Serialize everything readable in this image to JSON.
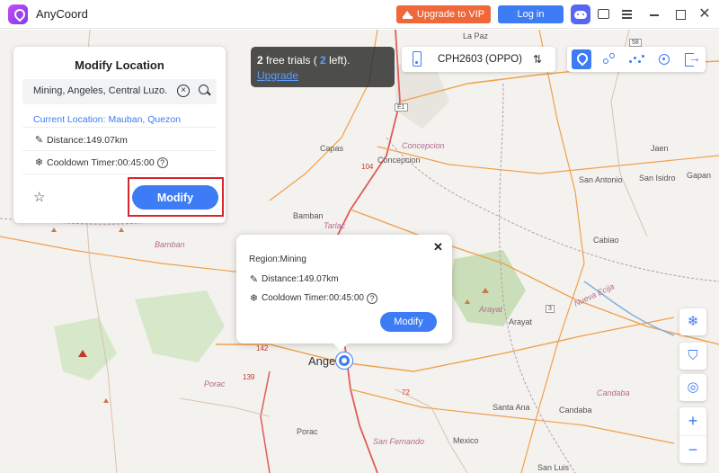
{
  "app": {
    "title": "AnyCoord"
  },
  "titlebar": {
    "upgrade_label": "Upgrade to VIP",
    "login_label": "Log in",
    "close_glyph": "✕"
  },
  "modify_panel": {
    "title": "Modify Location",
    "search_value": "Mining, Angeles, Central Luzo...",
    "current_location": "Current Location: Mauban, Quezon",
    "distance": "Distance:149.07km",
    "cooldown": "Cooldown Timer:00:45:00",
    "modify_label": "Modify"
  },
  "trial": {
    "count": "2",
    "text_mid": " free trials ( ",
    "left_count": "2",
    "text_end": " left).",
    "upgrade_link": "Upgrade"
  },
  "device": {
    "name": "CPH2603 (OPPO)"
  },
  "popup": {
    "region": "Region:Mining",
    "distance": "Distance:149.07km",
    "cooldown": "Cooldown Timer:00:45:00",
    "modify_label": "Modify",
    "close_glyph": "✕"
  },
  "map": {
    "places": [
      {
        "label": "La Paz",
        "style": "normal"
      },
      {
        "label": "Capas",
        "style": "normal"
      },
      {
        "label": "Concepcion",
        "style": "italic"
      },
      {
        "label": "Concepcion",
        "style": "normal"
      },
      {
        "label": "Jaen",
        "style": "normal"
      },
      {
        "label": "Gapan",
        "style": "normal"
      },
      {
        "label": "San Antonio",
        "style": "normal"
      },
      {
        "label": "San Isidro",
        "style": "normal"
      },
      {
        "label": "Bamban",
        "style": "normal"
      },
      {
        "label": "Bamban",
        "style": "italic"
      },
      {
        "label": "Tarlac",
        "style": "italic"
      },
      {
        "label": "Cabiao",
        "style": "normal"
      },
      {
        "label": "Arayat",
        "style": "italic"
      },
      {
        "label": "Arayat",
        "style": "normal"
      },
      {
        "label": "Angel",
        "style": "big"
      },
      {
        "label": "Porac",
        "style": "italic"
      },
      {
        "label": "Santa Ana",
        "style": "normal"
      },
      {
        "label": "Candaba",
        "style": "normal"
      },
      {
        "label": "Candaba",
        "style": "italic"
      },
      {
        "label": "Porac",
        "style": "normal"
      },
      {
        "label": "Mexico",
        "style": "normal"
      },
      {
        "label": "San Fernando",
        "style": "italic"
      },
      {
        "label": "San Luis",
        "style": "normal"
      },
      {
        "label": "Nueva Ecija",
        "style": "italic"
      }
    ],
    "road_labels": [
      "104",
      "142",
      "139",
      "72",
      "3"
    ],
    "shields": [
      "E1",
      "58",
      "3"
    ]
  },
  "icons": {
    "logo": "pin-logo-icon",
    "crown": "crown-icon",
    "discord": "discord-icon",
    "chat": "chat-icon",
    "menu": "menu-icon",
    "minimize": "minimize-icon",
    "maximize": "maximize-icon",
    "close": "close-icon"
  },
  "colors": {
    "accent": "#3d7cf4",
    "vip": "#f0673a",
    "highlight": "#d8262d"
  }
}
